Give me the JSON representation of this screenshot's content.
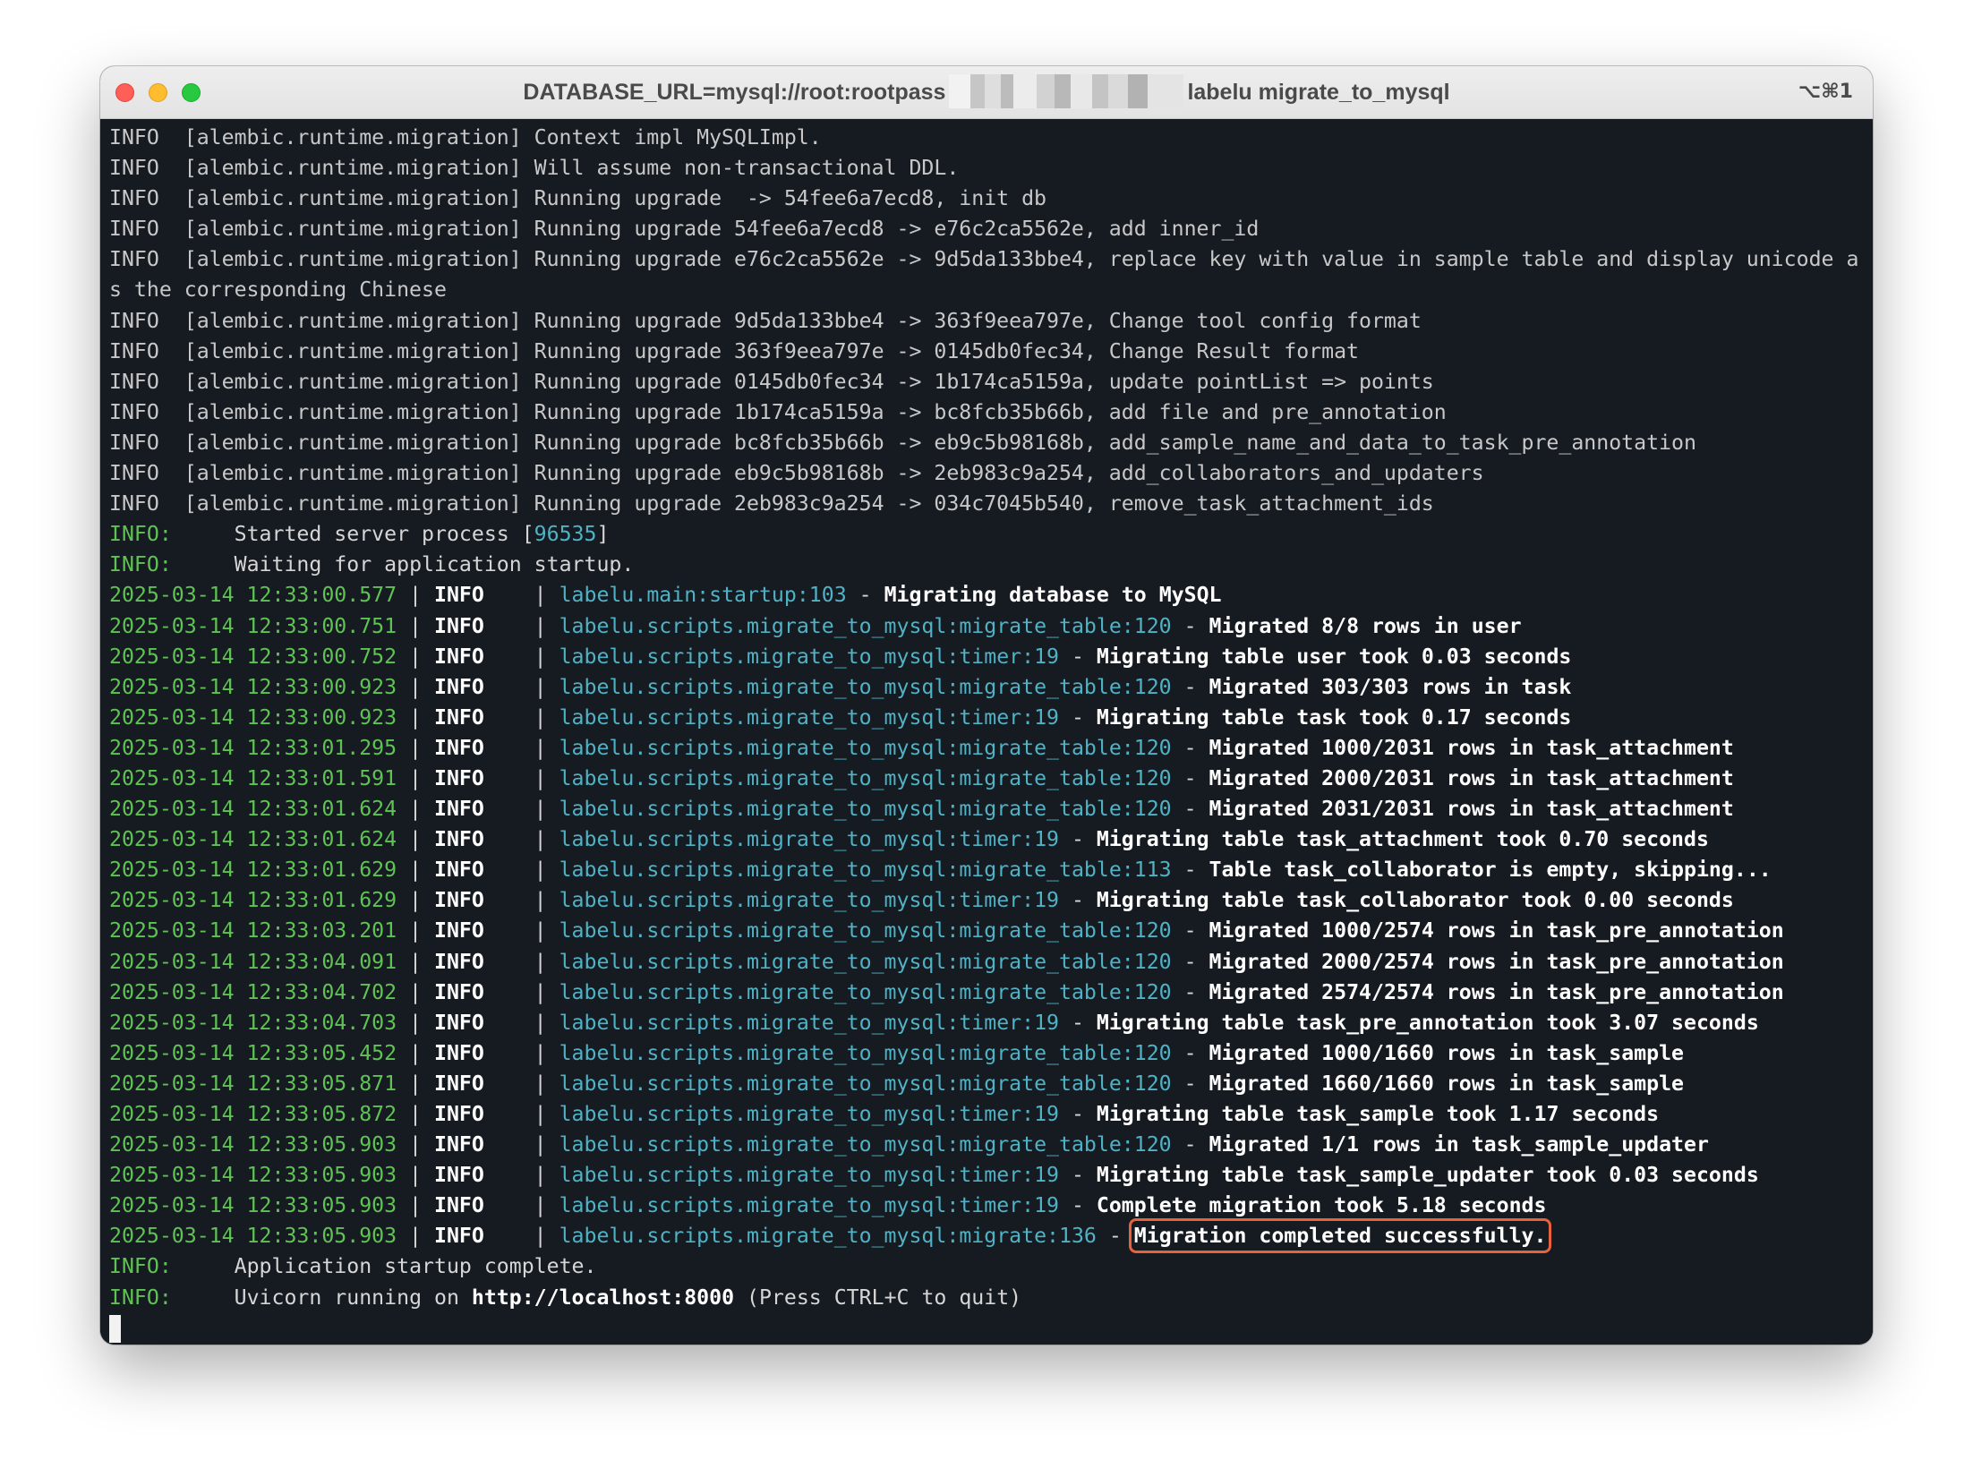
{
  "window": {
    "title_prefix": "DATABASE_URL=mysql://root:rootpass",
    "title_suffix": "labelu migrate_to_mysql",
    "shortcut": "⌥⌘1"
  },
  "colors": {
    "level_green": "#5fc354",
    "module_cyan": "#4fb2c5",
    "highlight_box": "#e8623a",
    "terminal_bg": "#161a21"
  },
  "alembic_lines": [
    "INFO  [alembic.runtime.migration] Context impl MySQLImpl.",
    "INFO  [alembic.runtime.migration] Will assume non-transactional DDL.",
    "INFO  [alembic.runtime.migration] Running upgrade  -> 54fee6a7ecd8, init db",
    "INFO  [alembic.runtime.migration] Running upgrade 54fee6a7ecd8 -> e76c2ca5562e, add inner_id",
    "INFO  [alembic.runtime.migration] Running upgrade e76c2ca5562e -> 9d5da133bbe4, replace key with value in sample table and display unicode a",
    "s the corresponding Chinese",
    "INFO  [alembic.runtime.migration] Running upgrade 9d5da133bbe4 -> 363f9eea797e, Change tool config format",
    "INFO  [alembic.runtime.migration] Running upgrade 363f9eea797e -> 0145db0fec34, Change Result format",
    "INFO  [alembic.runtime.migration] Running upgrade 0145db0fec34 -> 1b174ca5159a, update pointList => points",
    "INFO  [alembic.runtime.migration] Running upgrade 1b174ca5159a -> bc8fcb35b66b, add file and pre_annotation",
    "INFO  [alembic.runtime.migration] Running upgrade bc8fcb35b66b -> eb9c5b98168b, add_sample_name_and_data_to_task_pre_annotation",
    "INFO  [alembic.runtime.migration] Running upgrade eb9c5b98168b -> 2eb983c9a254, add_collaborators_and_updaters",
    "INFO  [alembic.runtime.migration] Running upgrade 2eb983c9a254 -> 034c7045b540, remove_task_attachment_ids"
  ],
  "uvicorn_start": [
    {
      "level": "INFO",
      "text": "Started server process [",
      "pid": "96535",
      "text_after": "]"
    },
    {
      "level": "INFO",
      "text": "Waiting for application startup.",
      "pid": "",
      "text_after": ""
    }
  ],
  "log_lines": [
    {
      "time": "2025-03-14 12:33:00.577",
      "level": "INFO",
      "source": "labelu.main:startup:103",
      "message": "Migrating database to MySQL"
    },
    {
      "time": "2025-03-14 12:33:00.751",
      "level": "INFO",
      "source": "labelu.scripts.migrate_to_mysql:migrate_table:120",
      "message": "Migrated 8/8 rows in user"
    },
    {
      "time": "2025-03-14 12:33:00.752",
      "level": "INFO",
      "source": "labelu.scripts.migrate_to_mysql:timer:19",
      "message": "Migrating table user took 0.03 seconds"
    },
    {
      "time": "2025-03-14 12:33:00.923",
      "level": "INFO",
      "source": "labelu.scripts.migrate_to_mysql:migrate_table:120",
      "message": "Migrated 303/303 rows in task"
    },
    {
      "time": "2025-03-14 12:33:00.923",
      "level": "INFO",
      "source": "labelu.scripts.migrate_to_mysql:timer:19",
      "message": "Migrating table task took 0.17 seconds"
    },
    {
      "time": "2025-03-14 12:33:01.295",
      "level": "INFO",
      "source": "labelu.scripts.migrate_to_mysql:migrate_table:120",
      "message": "Migrated 1000/2031 rows in task_attachment"
    },
    {
      "time": "2025-03-14 12:33:01.591",
      "level": "INFO",
      "source": "labelu.scripts.migrate_to_mysql:migrate_table:120",
      "message": "Migrated 2000/2031 rows in task_attachment"
    },
    {
      "time": "2025-03-14 12:33:01.624",
      "level": "INFO",
      "source": "labelu.scripts.migrate_to_mysql:migrate_table:120",
      "message": "Migrated 2031/2031 rows in task_attachment"
    },
    {
      "time": "2025-03-14 12:33:01.624",
      "level": "INFO",
      "source": "labelu.scripts.migrate_to_mysql:timer:19",
      "message": "Migrating table task_attachment took 0.70 seconds"
    },
    {
      "time": "2025-03-14 12:33:01.629",
      "level": "INFO",
      "source": "labelu.scripts.migrate_to_mysql:migrate_table:113",
      "message": "Table task_collaborator is empty, skipping..."
    },
    {
      "time": "2025-03-14 12:33:01.629",
      "level": "INFO",
      "source": "labelu.scripts.migrate_to_mysql:timer:19",
      "message": "Migrating table task_collaborator took 0.00 seconds"
    },
    {
      "time": "2025-03-14 12:33:03.201",
      "level": "INFO",
      "source": "labelu.scripts.migrate_to_mysql:migrate_table:120",
      "message": "Migrated 1000/2574 rows in task_pre_annotation"
    },
    {
      "time": "2025-03-14 12:33:04.091",
      "level": "INFO",
      "source": "labelu.scripts.migrate_to_mysql:migrate_table:120",
      "message": "Migrated 2000/2574 rows in task_pre_annotation"
    },
    {
      "time": "2025-03-14 12:33:04.702",
      "level": "INFO",
      "source": "labelu.scripts.migrate_to_mysql:migrate_table:120",
      "message": "Migrated 2574/2574 rows in task_pre_annotation"
    },
    {
      "time": "2025-03-14 12:33:04.703",
      "level": "INFO",
      "source": "labelu.scripts.migrate_to_mysql:timer:19",
      "message": "Migrating table task_pre_annotation took 3.07 seconds"
    },
    {
      "time": "2025-03-14 12:33:05.452",
      "level": "INFO",
      "source": "labelu.scripts.migrate_to_mysql:migrate_table:120",
      "message": "Migrated 1000/1660 rows in task_sample"
    },
    {
      "time": "2025-03-14 12:33:05.871",
      "level": "INFO",
      "source": "labelu.scripts.migrate_to_mysql:migrate_table:120",
      "message": "Migrated 1660/1660 rows in task_sample"
    },
    {
      "time": "2025-03-14 12:33:05.872",
      "level": "INFO",
      "source": "labelu.scripts.migrate_to_mysql:timer:19",
      "message": "Migrating table task_sample took 1.17 seconds"
    },
    {
      "time": "2025-03-14 12:33:05.903",
      "level": "INFO",
      "source": "labelu.scripts.migrate_to_mysql:migrate_table:120",
      "message": "Migrated 1/1 rows in task_sample_updater"
    },
    {
      "time": "2025-03-14 12:33:05.903",
      "level": "INFO",
      "source": "labelu.scripts.migrate_to_mysql:timer:19",
      "message": "Migrating table task_sample_updater took 0.03 seconds"
    },
    {
      "time": "2025-03-14 12:33:05.903",
      "level": "INFO",
      "source": "labelu.scripts.migrate_to_mysql:timer:19",
      "message": "Complete migration took 5.18 seconds"
    },
    {
      "time": "2025-03-14 12:33:05.903",
      "level": "INFO",
      "source": "labelu.scripts.migrate_to_mysql:migrate:136",
      "message": "Migration completed successfully.",
      "highlighted": true
    }
  ],
  "uvicorn_end": {
    "startup_complete": {
      "level": "INFO",
      "text": "Application startup complete."
    },
    "running": {
      "level": "INFO",
      "prefix": "Uvicorn running on ",
      "url": "http://localhost:8000",
      "suffix": " (Press CTRL+C to quit)"
    }
  }
}
